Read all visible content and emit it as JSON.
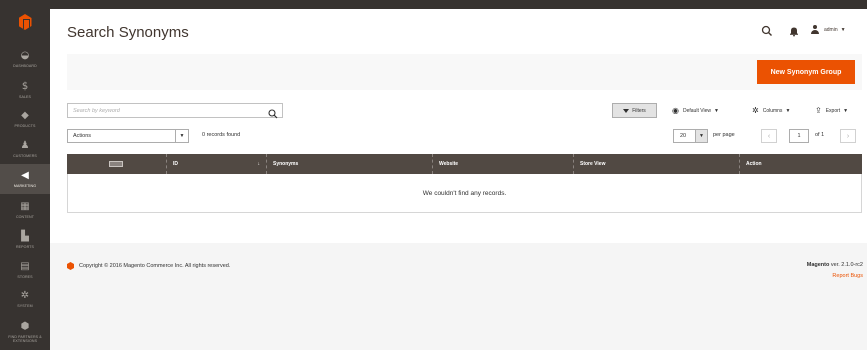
{
  "sidebar": {
    "items": [
      {
        "label": "Dashboard",
        "icon": "dashboard-icon",
        "glyph": "◒"
      },
      {
        "label": "Sales",
        "icon": "dollar-icon",
        "glyph": "$"
      },
      {
        "label": "Products",
        "icon": "cube-icon",
        "glyph": "◆"
      },
      {
        "label": "Customers",
        "icon": "person-icon",
        "glyph": "♟"
      },
      {
        "label": "Marketing",
        "icon": "megaphone-icon",
        "glyph": "◀"
      },
      {
        "label": "Content",
        "icon": "content-icon",
        "glyph": "▦"
      },
      {
        "label": "Reports",
        "icon": "bar-chart-icon",
        "glyph": "▙"
      },
      {
        "label": "Stores",
        "icon": "store-icon",
        "glyph": "▤"
      },
      {
        "label": "System",
        "icon": "gear-icon",
        "glyph": "✲"
      },
      {
        "label": "Find Partners & Extensions",
        "icon": "extensions-icon",
        "glyph": "⬢"
      }
    ],
    "active": "Marketing"
  },
  "header": {
    "title": "Search Synonyms",
    "user": "admin"
  },
  "actionbar": {
    "primary_label": "New Synonym Group"
  },
  "toolbar": {
    "search_placeholder": "Search by keyword",
    "filters_label": "Filters",
    "view_label": "Default View",
    "columns_label": "Columns",
    "export_label": "Export",
    "actions_label": "Actions",
    "records_found": "0 records found",
    "per_page_value": "20",
    "per_page_label": "per page",
    "page_current": "1",
    "page_of": "of 1"
  },
  "grid": {
    "columns": [
      "",
      "ID",
      "Synonyms",
      "Website",
      "Store View",
      "Action"
    ],
    "empty_message": "We couldn't find any records."
  },
  "footer": {
    "copyright": "Copyright © 2016 Magento Commerce Inc. All rights reserved.",
    "brand": "Magento",
    "version": "ver. 2.1.0-rc2",
    "report_bugs": "Report Bugs"
  },
  "colors": {
    "sidebar": "#373330",
    "accent": "#eb5202",
    "grid_header": "#514943",
    "footer_bg": "#f5f5f5"
  }
}
